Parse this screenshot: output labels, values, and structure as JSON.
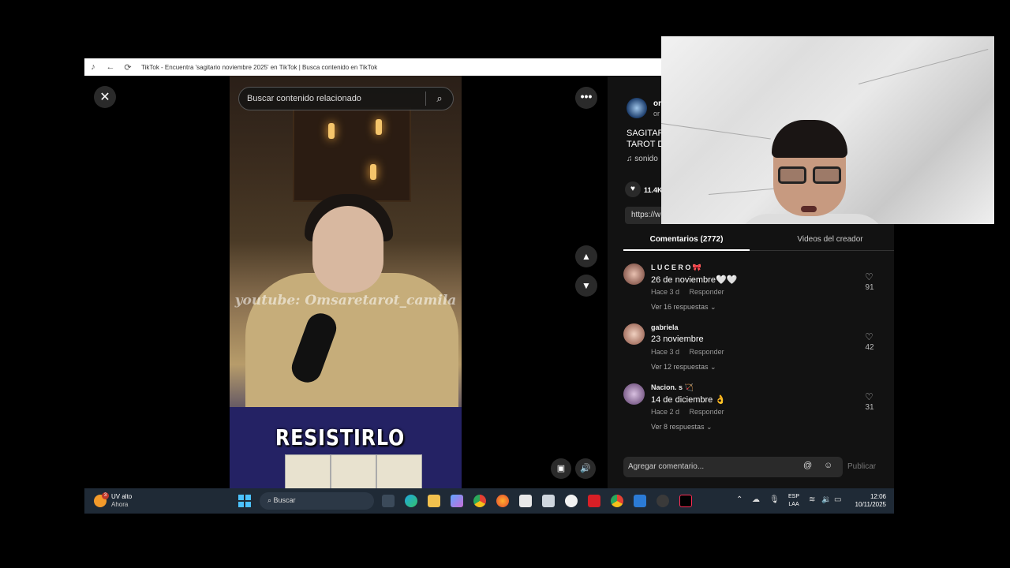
{
  "browser": {
    "title": "TikTok - Encuentra 'sagitario noviembre 2025' en TikTok | Busca contenido en TikTok"
  },
  "viewer": {
    "search_placeholder": "Buscar contenido relacionado",
    "watermark": "youtube: Omsaretarot_camila",
    "caption": "RESISTIRLO"
  },
  "panel": {
    "author_name": "or",
    "author_sub": "or",
    "description": "SAGITAR\nTAROT D",
    "sound": "sonido",
    "likes": "11.4K",
    "link": "https://w",
    "tabs": {
      "comments": "Comentarios (2772)",
      "creator_videos": "Videos del creador"
    },
    "comments": [
      {
        "user": "L U C E R O 🎀",
        "text": "26 de noviembre🤍🤍",
        "time": "Hace 3 d",
        "reply": "Responder",
        "replies": "Ver 16 respuestas ⌄",
        "likes": "91"
      },
      {
        "user": "gabriela",
        "text": "23 noviembre",
        "time": "Hace 3 d",
        "reply": "Responder",
        "replies": "Ver 12 respuestas ⌄",
        "likes": "42"
      },
      {
        "user": "Nacion. s 🏹",
        "text": "14 de diciembre 👌",
        "time": "Hace 2 d",
        "reply": "Responder",
        "replies": "Ver 8 respuestas ⌄",
        "likes": "31"
      }
    ],
    "composer_placeholder": "Agregar comentario...",
    "publish": "Publicar"
  },
  "taskbar": {
    "weather_title": "UV alto",
    "weather_sub": "Ahora",
    "weather_badge": "3",
    "search": "Buscar",
    "lang_1": "ESP",
    "lang_2": "LAA",
    "time": "12:06",
    "date": "10/11/2025"
  },
  "colors": {
    "accent_badge": "#c0392b",
    "taskbar": "#1f2a36",
    "panel_bg": "#121212"
  }
}
